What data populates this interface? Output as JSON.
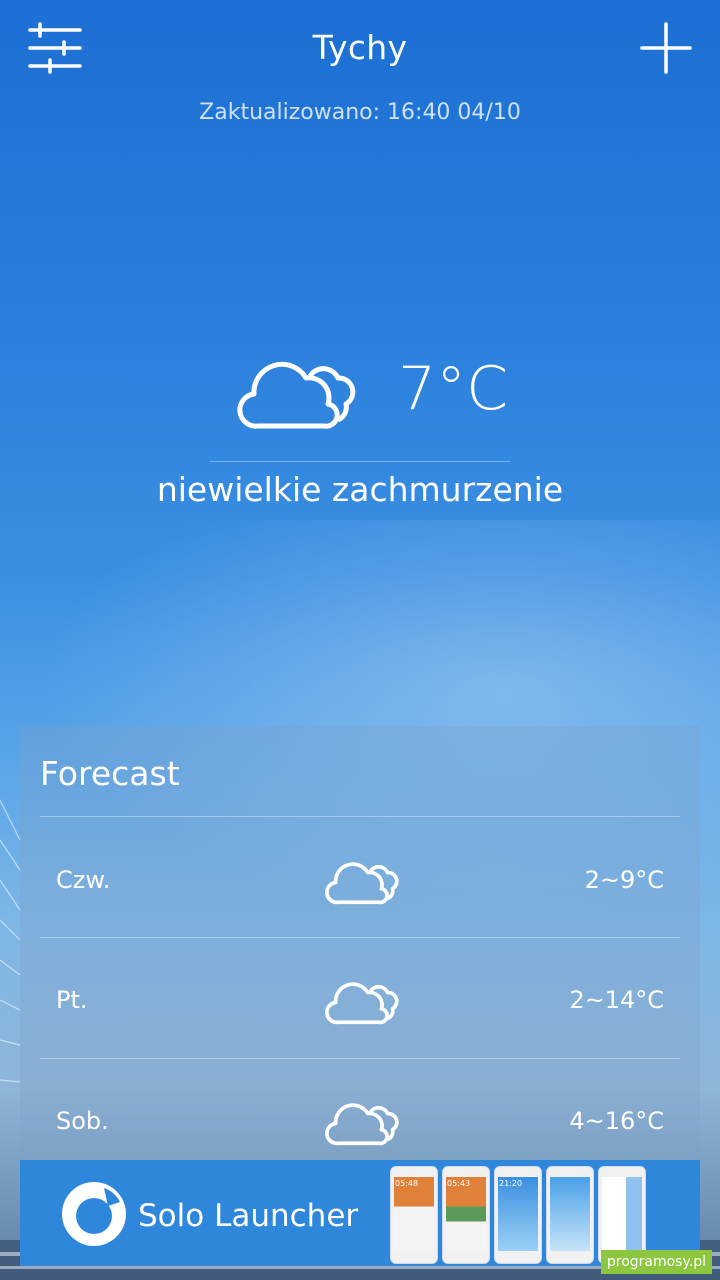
{
  "header": {
    "city": "Tychy",
    "updated": "Zaktualizowano: 16:40 04/10",
    "settings_icon": "sliders-icon",
    "add_icon": "plus-icon"
  },
  "current": {
    "temperature": "7°C",
    "condition": "niewielkie zachmurzenie",
    "icon": "clouds-icon"
  },
  "forecast": {
    "title": "Forecast",
    "days": [
      {
        "day": "Czw.",
        "range": "2~9°C",
        "icon": "clouds-icon"
      },
      {
        "day": "Pt.",
        "range": "2~14°C",
        "icon": "clouds-icon"
      },
      {
        "day": "Sob.",
        "range": "4~16°C",
        "icon": "clouds-icon"
      }
    ]
  },
  "ad": {
    "text": "Solo Launcher",
    "screens": [
      "05:48",
      "05:43",
      "21:20",
      "",
      ""
    ]
  },
  "watermark": "programosy.pl",
  "colors": {
    "sky_top": "#1c6fd3",
    "sky_bottom": "#5f7fa3",
    "ad_background": "#2e87da",
    "watermark_bg": "#8dc63f"
  }
}
